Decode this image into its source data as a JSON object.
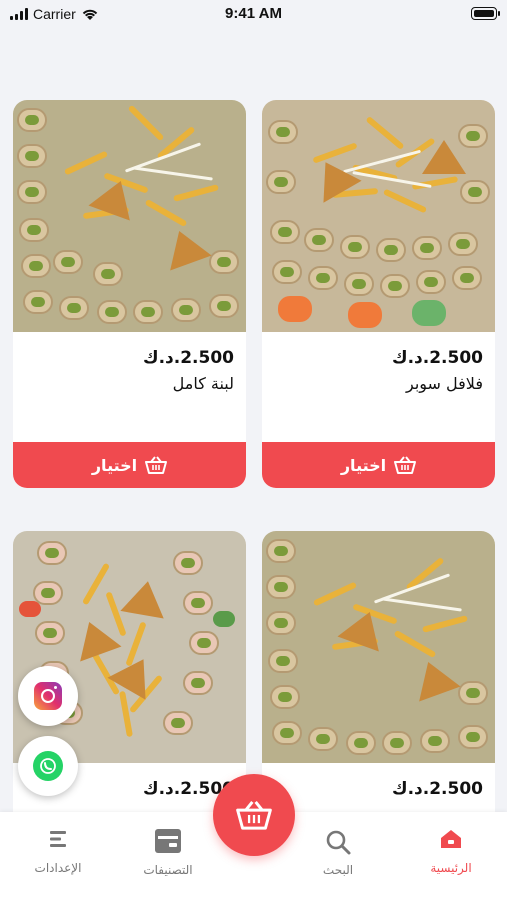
{
  "status_bar": {
    "carrier": "Carrier",
    "time": "9:41 AM"
  },
  "products": [
    {
      "price": "2.500.د.ك",
      "name": "فلافل سوبر",
      "button": "اختيار"
    },
    {
      "price": "2.500.د.ك",
      "name": "لبنة كامل",
      "button": "اختيار"
    },
    {
      "price": "2.500.د.ك",
      "name": ""
    },
    {
      "price": "2.500.د.ك",
      "name": ""
    }
  ],
  "nav": {
    "home": "الرئيسية",
    "search": "البحث",
    "categories": "التصنيفات",
    "settings": "الإعدادات"
  },
  "colors": {
    "accent": "#f04a4f",
    "background": "#f2f3f7"
  }
}
